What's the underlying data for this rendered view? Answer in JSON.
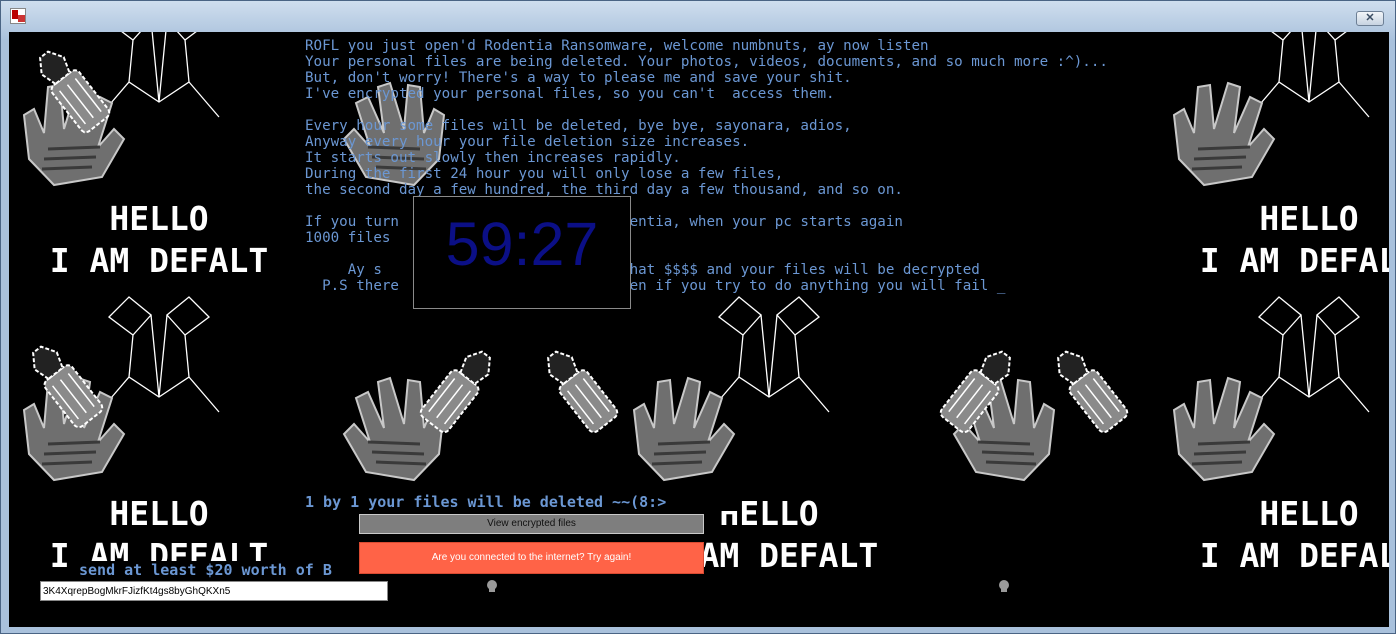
{
  "window": {
    "close_label": "✕"
  },
  "ransom_note": {
    "lines": [
      "ROFL you just open'd Rodentia Ransomware, welcome numbnuts, ay now listen",
      "Your personal files are being deleted. Your photos, videos, documents, and so much more :^)...",
      "But, don't worry! There's a way to please me and save your shit.",
      "I've encrypted your personal files, so you can't  access them.",
      "",
      "Every hour some files will be deleted, bye bye, sayonara, adios,",
      "Anyway every hour your file deletion size increases.",
      "It starts out slowly then increases rapidly.",
      "During the first 24 hour you will only lose a few files,",
      "the second day a few hundred, the third day a few thousand, and so on.",
      "",
      "If you turn                  close Rodentia, when your pc starts again",
      "1000 files                   ishment.",
      "",
      "     Ay s                    send me that $$$$ and your files will be decrypted",
      "  P.S there                  e that even if you try to do anything you will fail _"
    ]
  },
  "timer": {
    "value": "59:27"
  },
  "status": {
    "deleted_text": "1 by 1 your files will be deleted ~~(8:>",
    "send_text": "send at least $20 worth of B"
  },
  "buttons": {
    "view_encrypted": "View encrypted files",
    "retry": "Are you connected to the internet? Try again!"
  },
  "wallet": {
    "address": "3K4XqrepBogMkrFJizfKt4gs8byGhQKXn5"
  },
  "art": {
    "caption_line1": "HELLO",
    "caption_line2": "I AM DEFALT"
  },
  "colors": {
    "text_blue": "#6b97d3",
    "timer_blue": "#0b0f86",
    "retry_red": "#ff6347",
    "button_gray": "#7e7e7e"
  }
}
